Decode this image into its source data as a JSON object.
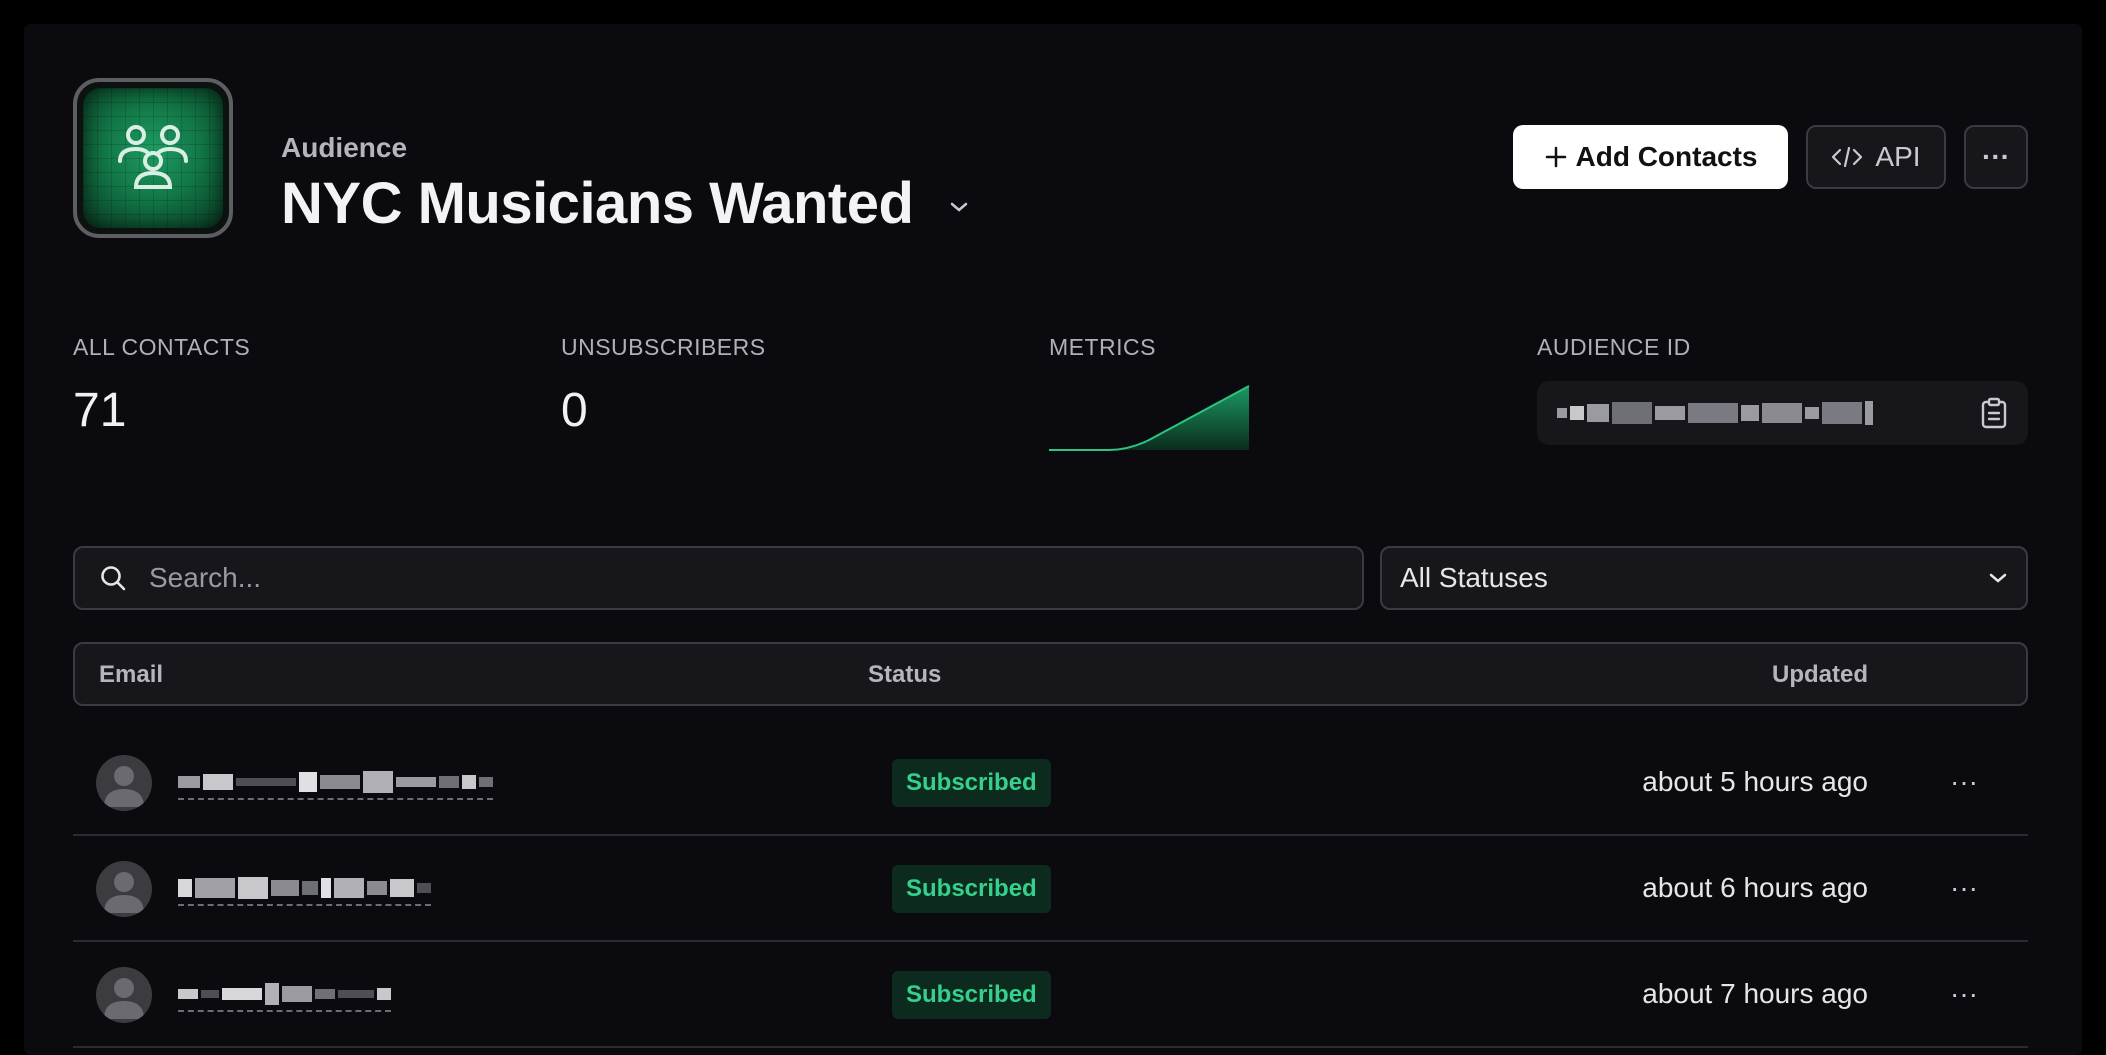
{
  "header": {
    "eyebrow": "Audience",
    "title": "NYC Musicians Wanted",
    "add_contacts_label": "Add Contacts",
    "api_label": "API",
    "more_label": "···"
  },
  "stats": {
    "all_contacts_label": "ALL CONTACTS",
    "all_contacts_value": "71",
    "unsubscribers_label": "UNSUBSCRIBERS",
    "unsubscribers_value": "0",
    "metrics_label": "METRICS",
    "audience_id_label": "AUDIENCE ID"
  },
  "filters": {
    "search_placeholder": "Search...",
    "status_selected": "All Statuses"
  },
  "table": {
    "columns": {
      "email": "Email",
      "status": "Status",
      "updated": "Updated"
    },
    "rows": [
      {
        "status": "Subscribed",
        "updated": "about 5 hours ago"
      },
      {
        "status": "Subscribed",
        "updated": "about 6 hours ago"
      },
      {
        "status": "Subscribed",
        "updated": "about 7 hours ago"
      }
    ],
    "row_more_label": "···"
  },
  "colors": {
    "accent": "#35d08c",
    "badge_bg": "#0d2a1f",
    "background": "#0a0a0f"
  },
  "icons": [
    "audience-logo-icon",
    "chevron-down-icon",
    "plus-icon",
    "code-icon",
    "copy-clipboard-icon",
    "search-icon",
    "avatar-icon"
  ]
}
